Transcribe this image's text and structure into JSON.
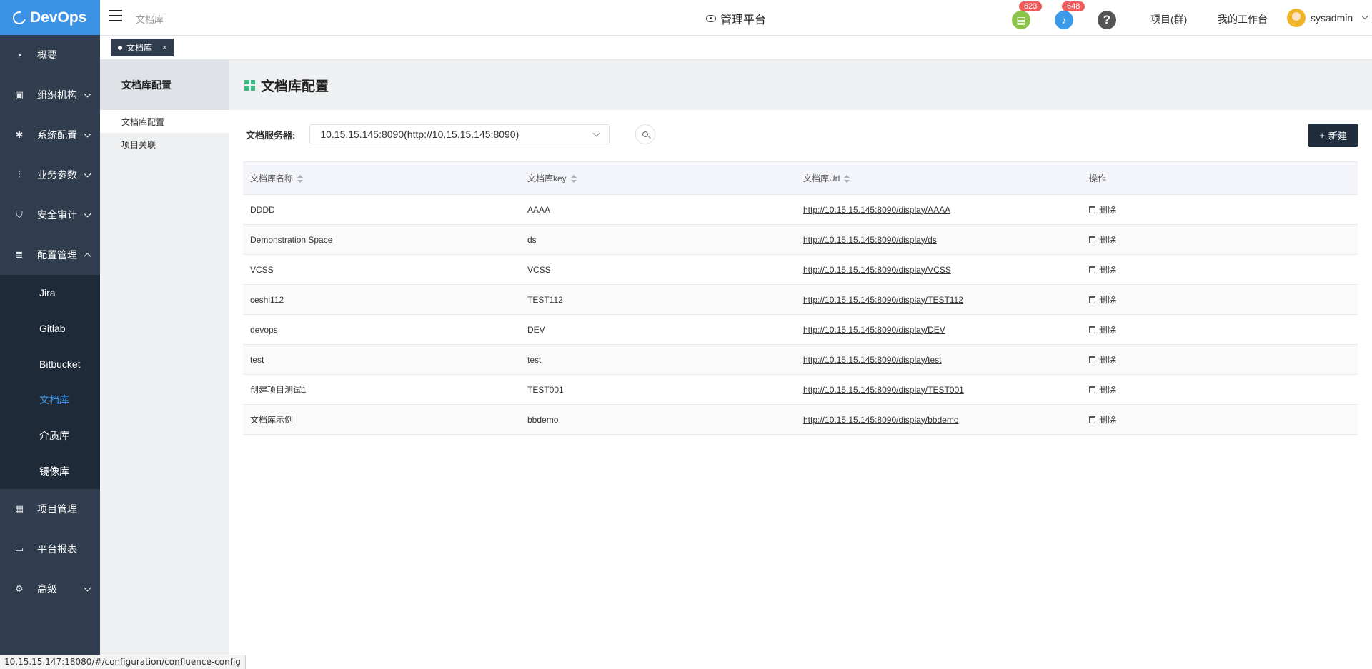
{
  "app": {
    "logo": "DevOps"
  },
  "header": {
    "breadcrumb": "文档库",
    "platform": "管理平台",
    "doc_badge": "623",
    "notify_badge": "648",
    "help": "?",
    "project_group": "项目(群)",
    "workbench": "我的工作台",
    "username": "sysadmin"
  },
  "tab": {
    "label": "文档库",
    "close": "×"
  },
  "sidebar": {
    "items": [
      {
        "label": "概要",
        "icon": "dashboard-icon"
      },
      {
        "label": "组织机构",
        "icon": "lock-icon"
      },
      {
        "label": "系统配置",
        "icon": "gear-icon"
      },
      {
        "label": "业务参数",
        "icon": "sliders-icon"
      },
      {
        "label": "安全审计",
        "icon": "shield-icon"
      },
      {
        "label": "配置管理",
        "icon": "database-icon"
      },
      {
        "label": "项目管理",
        "icon": "grid-icon"
      },
      {
        "label": "平台报表",
        "icon": "monitor-icon"
      },
      {
        "label": "高级",
        "icon": "cog-icon"
      }
    ],
    "submenu": [
      "Jira",
      "Gitlab",
      "Bitbucket",
      "文档库",
      "介质库",
      "镜像库"
    ]
  },
  "subside": {
    "title": "文档库配置",
    "items": [
      "文档库配置",
      "项目关联"
    ]
  },
  "main": {
    "title": "文档库配置",
    "server_label": "文档服务器:",
    "server_value": "10.15.15.145:8090(http://10.15.15.145:8090)",
    "new_button": "新建",
    "columns": [
      "文档库名称",
      "文档库key",
      "文档库Url",
      "操作"
    ],
    "delete_label": "删除",
    "rows": [
      {
        "name": "DDDD",
        "key": "AAAA",
        "url": "http://10.15.15.145:8090/display/AAAA"
      },
      {
        "name": "Demonstration Space",
        "key": "ds",
        "url": "http://10.15.15.145:8090/display/ds"
      },
      {
        "name": "VCSS",
        "key": "VCSS",
        "url": "http://10.15.15.145:8090/display/VCSS"
      },
      {
        "name": "ceshi112",
        "key": "TEST112",
        "url": "http://10.15.15.145:8090/display/TEST112"
      },
      {
        "name": "devops",
        "key": "DEV",
        "url": "http://10.15.15.145:8090/display/DEV"
      },
      {
        "name": "test",
        "key": "test",
        "url": "http://10.15.15.145:8090/display/test"
      },
      {
        "name": "创建项目测试1",
        "key": "TEST001",
        "url": "http://10.15.15.145:8090/display/TEST001"
      },
      {
        "name": "文档库示例",
        "key": "bbdemo",
        "url": "http://10.15.15.145:8090/display/bbdemo"
      }
    ]
  },
  "status_url": "10.15.15.147:18080/#/configuration/confluence-config"
}
